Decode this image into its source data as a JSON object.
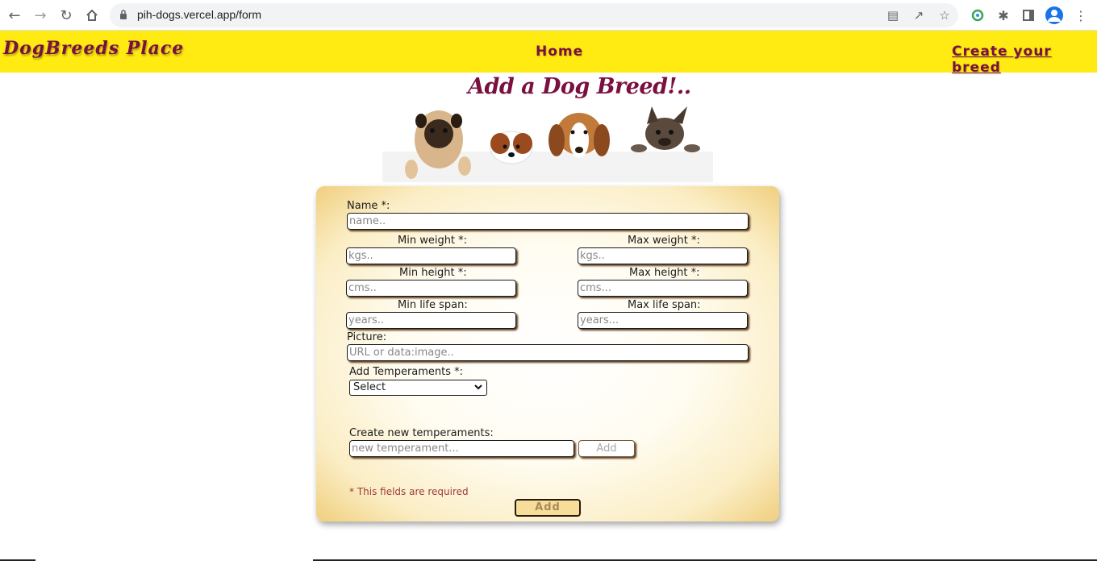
{
  "browser": {
    "url": "pih-dogs.vercel.app/form"
  },
  "navbar": {
    "logo": "DogBreeds Place",
    "home": "Home",
    "create": "Create your breed",
    "background": "#ffea12",
    "accent": "#7a1040"
  },
  "heading": "Add a Dog Breed!..",
  "form": {
    "name_label": "Name *:",
    "name_placeholder": "name..",
    "min_weight_label": "Min weight *:",
    "min_weight_placeholder": "kgs..",
    "max_weight_label": "Max weight *:",
    "max_weight_placeholder": "kgs..",
    "min_height_label": "Min height *:",
    "min_height_placeholder": "cms..",
    "max_height_label": "Max height *:",
    "max_height_placeholder": "cms...",
    "min_life_label": "Min life span:",
    "min_life_placeholder": "years..",
    "max_life_label": "Max life span:",
    "max_life_placeholder": "years...",
    "picture_label": "Picture:",
    "picture_placeholder": "URL or data:image..",
    "temperaments_label": "Add Temperaments *:",
    "temperaments_selected": "Select",
    "new_temperament_label": "Create new temperaments:",
    "new_temperament_placeholder": "new temperament...",
    "add_temperament_button": "Add",
    "required_note": "* This fields are required",
    "submit_button": "Add"
  }
}
